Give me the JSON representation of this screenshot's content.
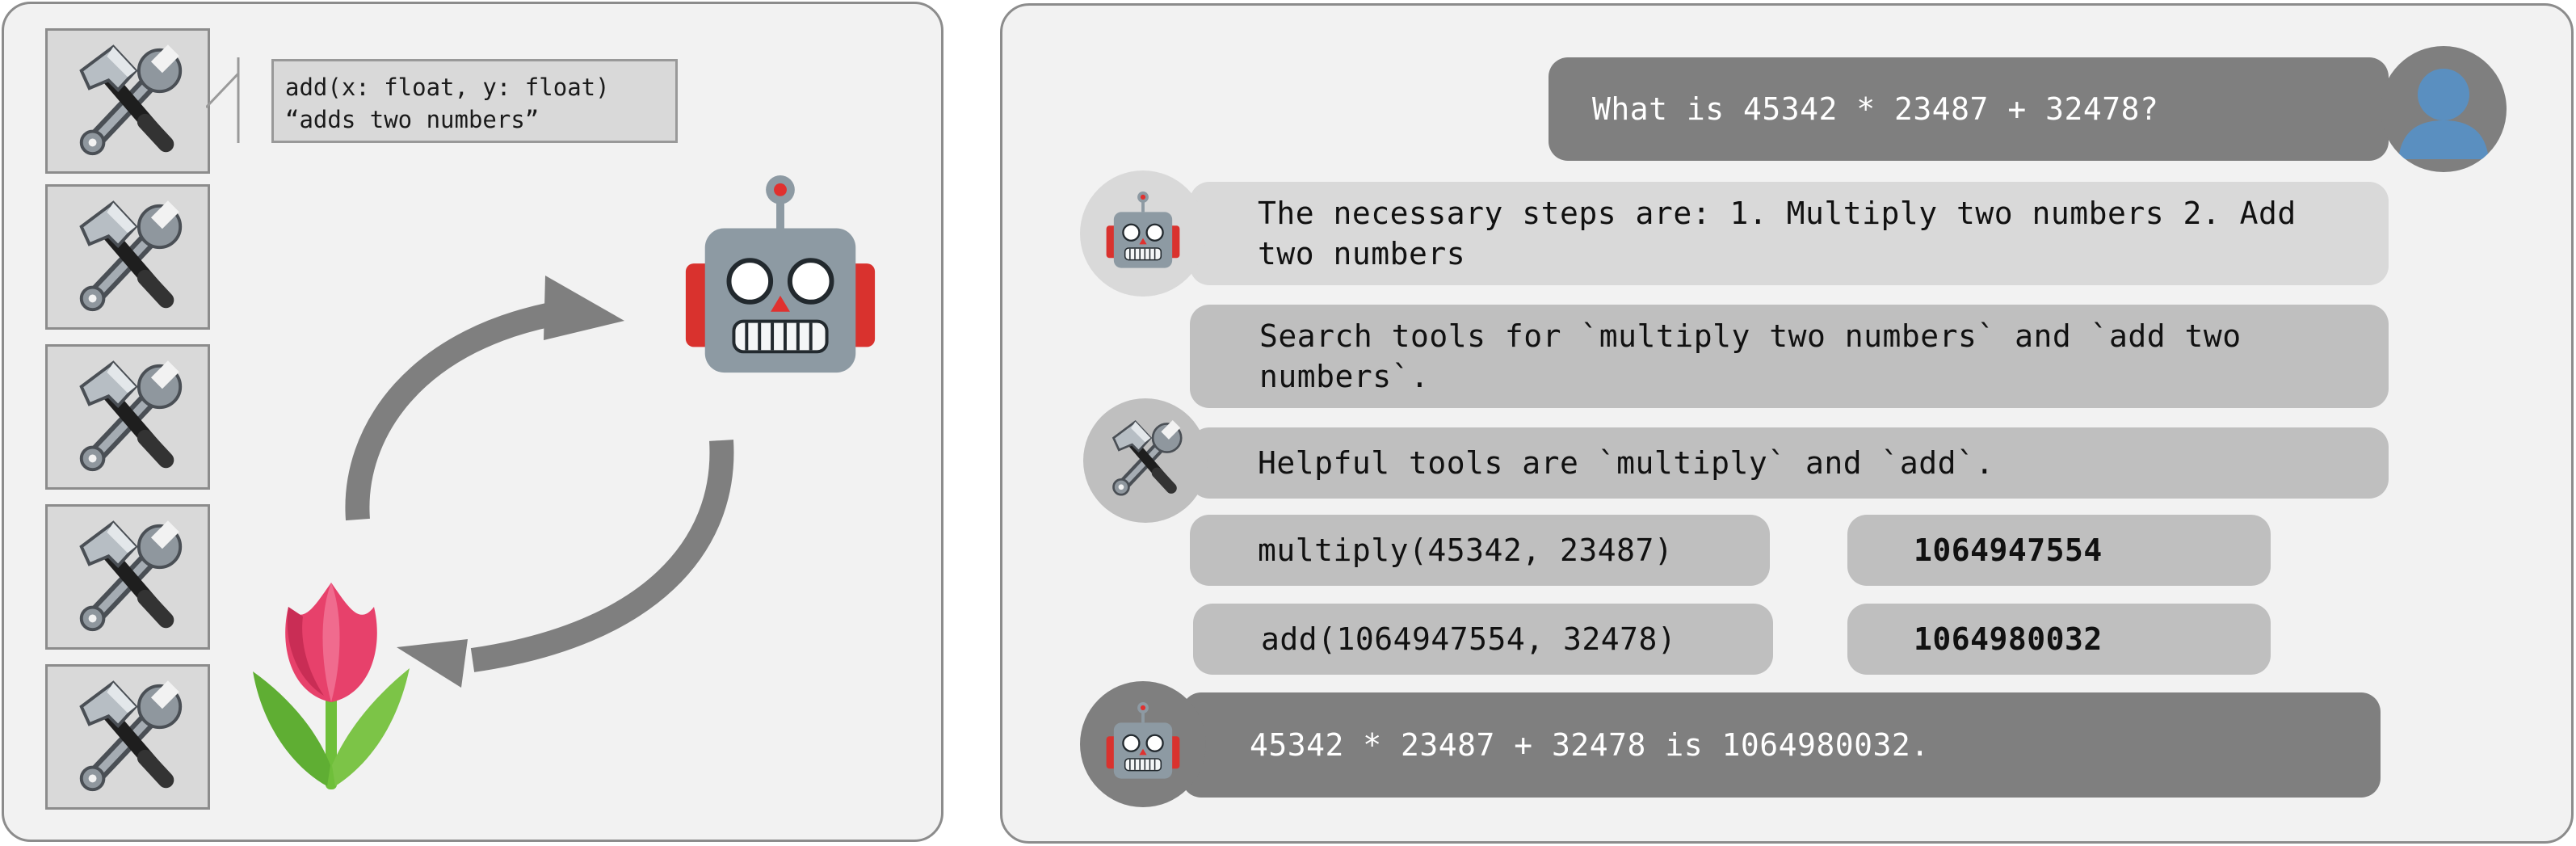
{
  "tool_tooltip": {
    "signature": "add(x: float, y: float)",
    "description": "“adds two numbers”"
  },
  "chat": {
    "user_question": "What is 45342 * 23487 + 32478?",
    "agent_plan": "The necessary steps are: 1. Multiply two numbers 2. Add two numbers",
    "search_request": "Search tools for `multiply two numbers` and `add two numbers`.",
    "tool_result": "Helpful tools are `multiply` and `add`.",
    "calls": [
      {
        "call": "multiply(45342, 23487)",
        "result": "1064947554"
      },
      {
        "call": "add(1064947554, 32478)",
        "result": "1064980032"
      }
    ],
    "final_answer": "45342 * 23487 + 32478 is 1064980032."
  },
  "icons": {
    "tool": "hammer-and-wrench-icon",
    "agent": "robot-icon",
    "user": "user-silhouette-icon",
    "environment": "tulip-icon"
  }
}
